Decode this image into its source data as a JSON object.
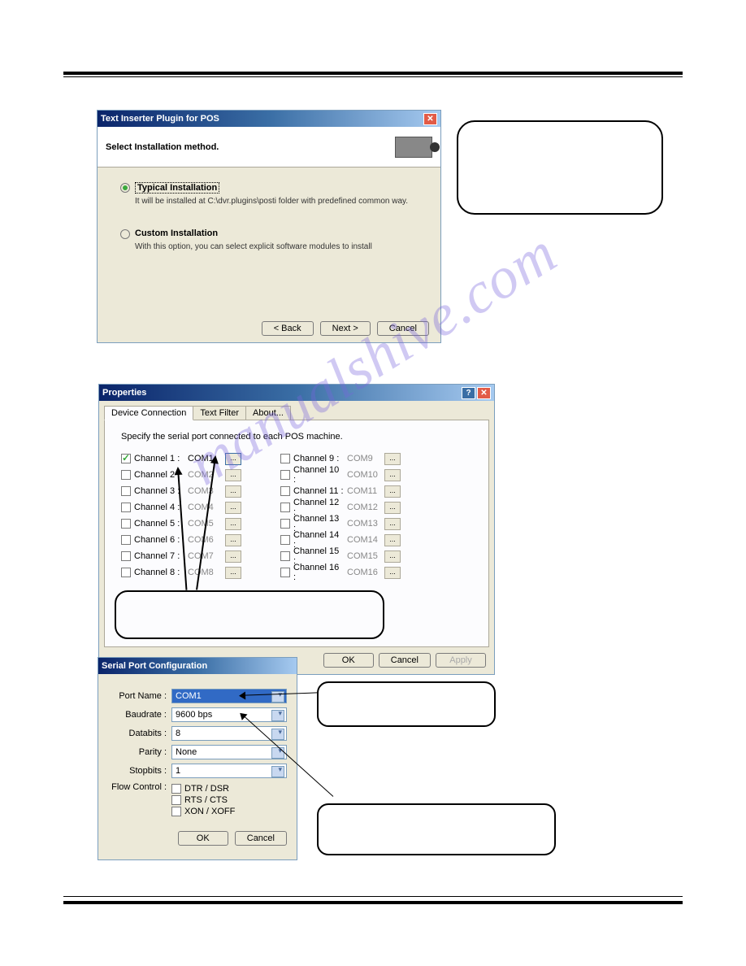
{
  "watermark": "manualshive.com",
  "dlg1": {
    "title": "Text Inserter Plugin for POS",
    "header": "Select Installation method.",
    "opt1_label": "Typical Installation",
    "opt1_desc": "It will be installed at C:\\dvr.plugins\\posti folder with predefined common way.",
    "opt2_label": "Custom Installation",
    "opt2_desc": "With this option, you can select explicit software modules to install",
    "back": "< Back",
    "next": "Next >",
    "cancel": "Cancel"
  },
  "dlg2": {
    "title": "Properties",
    "tab1": "Device Connection",
    "tab2": "Text Filter",
    "tab3": "About...",
    "desc": "Specify the serial port connected to each POS machine.",
    "channels_left": [
      {
        "label": "Channel 1 :",
        "com": "COM1",
        "checked": true
      },
      {
        "label": "Channel 2 :",
        "com": "COM2",
        "checked": false
      },
      {
        "label": "Channel 3 :",
        "com": "COM3",
        "checked": false
      },
      {
        "label": "Channel 4 :",
        "com": "COM4",
        "checked": false
      },
      {
        "label": "Channel 5 :",
        "com": "COM5",
        "checked": false
      },
      {
        "label": "Channel 6 :",
        "com": "COM6",
        "checked": false
      },
      {
        "label": "Channel 7 :",
        "com": "COM7",
        "checked": false
      },
      {
        "label": "Channel 8 :",
        "com": "COM8",
        "checked": false
      }
    ],
    "channels_right": [
      {
        "label": "Channel 9 :",
        "com": "COM9",
        "checked": false
      },
      {
        "label": "Channel 10 :",
        "com": "COM10",
        "checked": false
      },
      {
        "label": "Channel 11 :",
        "com": "COM11",
        "checked": false
      },
      {
        "label": "Channel 12 :",
        "com": "COM12",
        "checked": false
      },
      {
        "label": "Channel 13 :",
        "com": "COM13",
        "checked": false
      },
      {
        "label": "Channel 14 :",
        "com": "COM14",
        "checked": false
      },
      {
        "label": "Channel 15 :",
        "com": "COM15",
        "checked": false
      },
      {
        "label": "Channel 16 :",
        "com": "COM16",
        "checked": false
      }
    ],
    "ok": "OK",
    "cancel": "Cancel",
    "apply": "Apply"
  },
  "dlg3": {
    "title": "Serial Port Configuration",
    "port_label": "Port Name :",
    "port_val": "COM1",
    "baud_label": "Baudrate :",
    "baud_val": "9600 bps",
    "databits_label": "Databits :",
    "databits_val": "8",
    "parity_label": "Parity :",
    "parity_val": "None",
    "stopbits_label": "Stopbits :",
    "stopbits_val": "1",
    "fc_label": "Flow Control :",
    "fc1": "DTR / DSR",
    "fc2": "RTS / CTS",
    "fc3": "XON / XOFF",
    "ok": "OK",
    "cancel": "Cancel"
  }
}
